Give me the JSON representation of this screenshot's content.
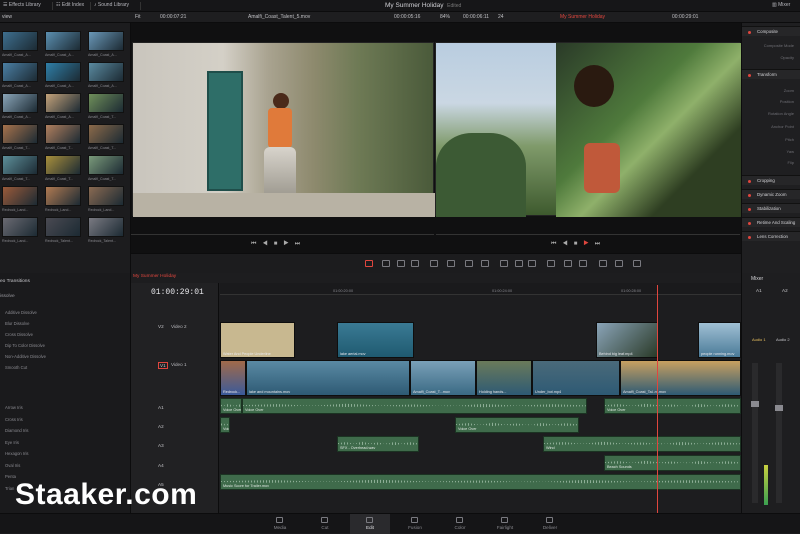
{
  "topbar": {
    "effects_library": "Effects Library",
    "edit_index": "Edit Index",
    "sound_library": "Sound Library",
    "project_title": "My Summer Holiday",
    "edited": "Edited",
    "mixer": "Mixer"
  },
  "secbar": {
    "view": "view",
    "fit": "Fit",
    "source_tc": "00:00:07:21",
    "clip_name": "Amalfi_Coast_Talent_5.mov",
    "clip_tc": "00:00:05:16",
    "zoom": "84%",
    "tc2": "00:00:06:11",
    "fps": "24",
    "timeline_name": "My Summer Holiday",
    "record_tc": "00:00:29:01"
  },
  "media": {
    "items": [
      {
        "label": "Amalfi_Coast_A...",
        "color": "#3e6f8f"
      },
      {
        "label": "Amalfi_Coast_A...",
        "color": "#5b8fb0"
      },
      {
        "label": "Amalfi_Coast_A...",
        "color": "#6a98b8"
      },
      {
        "label": "Amalfi_Coast_A...",
        "color": "#4b7fa4"
      },
      {
        "label": "Amalfi_Coast_A...",
        "color": "#2f7fa8"
      },
      {
        "label": "Amalfi_Coast_A...",
        "color": "#5a8aa0"
      },
      {
        "label": "Amalfi_Coast_A...",
        "color": "#8aa5b8"
      },
      {
        "label": "Amalfi_Coast_A...",
        "color": "#c3a27a"
      },
      {
        "label": "Amalfi_Coast_T...",
        "color": "#6f8f5a"
      },
      {
        "label": "Amalfi_Coast_T...",
        "color": "#a6724c"
      },
      {
        "label": "Amalfi_Coast_T...",
        "color": "#b07f5e"
      },
      {
        "label": "Amalfi_Coast_T...",
        "color": "#8c6a4a"
      },
      {
        "label": "Amalfi_Coast_T...",
        "color": "#5d8f9a"
      },
      {
        "label": "Amalfi_Coast_T...",
        "color": "#a88f3c"
      },
      {
        "label": "Amalfi_Coast_T...",
        "color": "#7a9a7a"
      },
      {
        "label": "Redrock_Land...",
        "color": "#9a5a3a"
      },
      {
        "label": "Redrock_Land...",
        "color": "#b07a52"
      },
      {
        "label": "Redrock_Land...",
        "color": "#8a6a52"
      },
      {
        "label": "Redrock_Land...",
        "color": "#6a6a72"
      },
      {
        "label": "Redrock_Talent...",
        "color": "#4a4a52"
      },
      {
        "label": "Redrock_Talent...",
        "color": "#7a7a82"
      }
    ]
  },
  "inspector": {
    "composite": "Composite",
    "composite_mode": "Composite Mode",
    "opacity": "Opacity",
    "transform": "Transform",
    "zoom": "Zoom",
    "position": "Position",
    "rotation_angle": "Rotation Angle",
    "anchor_point": "Anchor Point",
    "pitch": "Pitch",
    "yaw": "Yaw",
    "flip": "Flip",
    "cropping": "Cropping",
    "dynamic_zoom": "Dynamic Zoom",
    "stabilization": "Stabilization",
    "retime_scaling": "Retime And Scaling",
    "lens_correction": "Lens Correction"
  },
  "effects": {
    "section_transitions": "eo Transitions",
    "dissolve": "issolve",
    "items_dissolve": [
      "Additive Dissolve",
      "Blur Dissolve",
      "Cross Dissolve",
      "Dip To Color Dissolve",
      "Non-Additive Dissolve",
      "Smooth Cut"
    ],
    "items_iris": [
      "Arrow Iris",
      "Cross Iris",
      "Diamond Iris",
      "Eye Iris",
      "Hexagon Iris",
      "Oval Iris",
      "Penta",
      "Trian"
    ]
  },
  "timeline": {
    "name": "My Summer Holiday",
    "timecode": "01:00:29:01",
    "ruler": [
      "01:00:20:00",
      "01:00:24:00",
      "01:00:28:00"
    ],
    "tracks": {
      "v2": "V2",
      "v2_name": "Video 2",
      "v1": "V1",
      "v1_name": "Video 1",
      "a1": "A1",
      "a2": "A2",
      "a3": "A3",
      "a4": "A4",
      "a5": "A5",
      "ch": "2.0"
    },
    "clips_v2": [
      "Water And People Underline",
      "lake aerial.mov",
      "Behind big leaf.mp4",
      "people running.mov"
    ],
    "clips_v1": [
      "Redrock...",
      "lake and mountains.mov",
      "Amalfi_Coast_T...mov",
      "Holding hands...",
      "Under_bot.mp4",
      "Amalfi_Coast_Tal..nt.mov"
    ],
    "clips_audio": [
      "Voice Over",
      "Voice Over",
      "SFX - Overhead.wav",
      "Wind",
      "Beach Sounds",
      "Music Score for Trailer.mov"
    ]
  },
  "mixer": {
    "title": "Mixer",
    "a1": "A1",
    "a2": "A2",
    "audio1": "Audio 1",
    "audio2": "Audio 2"
  },
  "pages": [
    "Media",
    "Cut",
    "Edit",
    "Fusion",
    "Color",
    "Fairlight",
    "Deliver"
  ],
  "watermark": "Staaker.com"
}
